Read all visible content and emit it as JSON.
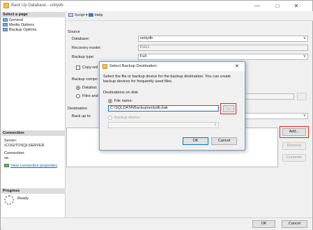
{
  "window": {
    "title": "Back Up Database - unitydb",
    "minimize": "—",
    "maximize": "□",
    "close": "✕"
  },
  "left_pane": {
    "select_page": "Select a page",
    "pages": [
      {
        "label": "General",
        "icon": "page-icon"
      },
      {
        "label": "Media Options",
        "icon": "page-icon"
      },
      {
        "label": "Backup Options",
        "icon": "page-icon"
      }
    ],
    "connection": {
      "header": "Connection",
      "server_label": "Server:",
      "server_value": "\\COGITOSQLSERVER",
      "connection_label": "Connection:",
      "connection_value": "sa",
      "view_link": "View connection properties"
    },
    "progress": {
      "header": "Progress",
      "status": "Ready"
    }
  },
  "toolbar": {
    "script": "Script",
    "help": "Help"
  },
  "source": {
    "section": "Source",
    "database_label": "Database:",
    "database_value": "unitydb",
    "recovery_label": "Recovery model:",
    "recovery_value": "FULL",
    "backup_type_label": "Backup type:",
    "backup_type_value": "Full",
    "copy_only_label": "Copy-onl",
    "backup_component_label": "Backup compo",
    "database_radio": "Databas",
    "files_radio": "Files and"
  },
  "destination": {
    "section": "Destination",
    "backup_to_label": "Back up to:",
    "add_button": "Add...",
    "remove_button": "Remove",
    "contents_button": "Contents"
  },
  "dialog": {
    "title": "Select Backup Destination",
    "close": "✕",
    "description": "Select the file or backup device for the backup destination. You can create backup devices for frequently used files.",
    "destinations_label": "Destinations on disk",
    "file_name_label": "File name:",
    "file_name_value": "C:\\SQLDATA\\Backup\\unitydb.bak",
    "browse_button": "...",
    "backup_device_label": "Backup device:",
    "ok_button": "OK",
    "cancel_button": "Cancel"
  },
  "footer": {
    "ok_button": "OK",
    "cancel_button": "Cancel"
  },
  "colors": {
    "highlight": "#e02020",
    "link": "#1a5fb4",
    "accent": "#0078d7"
  }
}
